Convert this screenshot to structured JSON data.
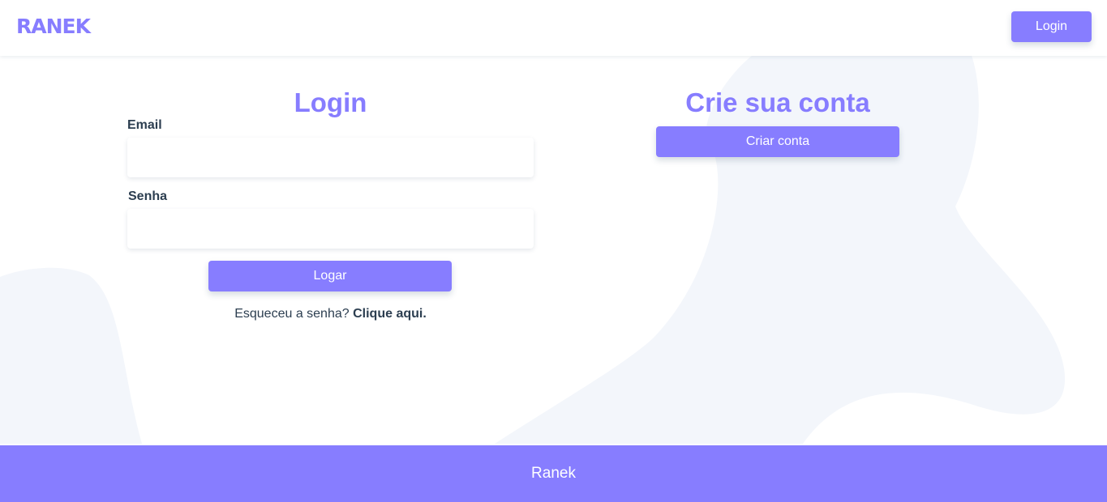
{
  "header": {
    "logo": "RANEK",
    "login_button": "Login"
  },
  "login": {
    "title": "Login",
    "email_label": "Email",
    "email_value": "",
    "password_label": "Senha",
    "password_value": "",
    "submit_label": "Logar",
    "forgot_text": "Esqueceu a senha?",
    "forgot_link": "Clique aqui."
  },
  "signup": {
    "title": "Crie sua conta",
    "button_label": "Criar conta"
  },
  "footer": {
    "text": "Ranek"
  },
  "colors": {
    "accent": "#877dff",
    "text": "#2c3e50",
    "background_blob": "#f3f6fb",
    "surface": "#ffffff"
  }
}
